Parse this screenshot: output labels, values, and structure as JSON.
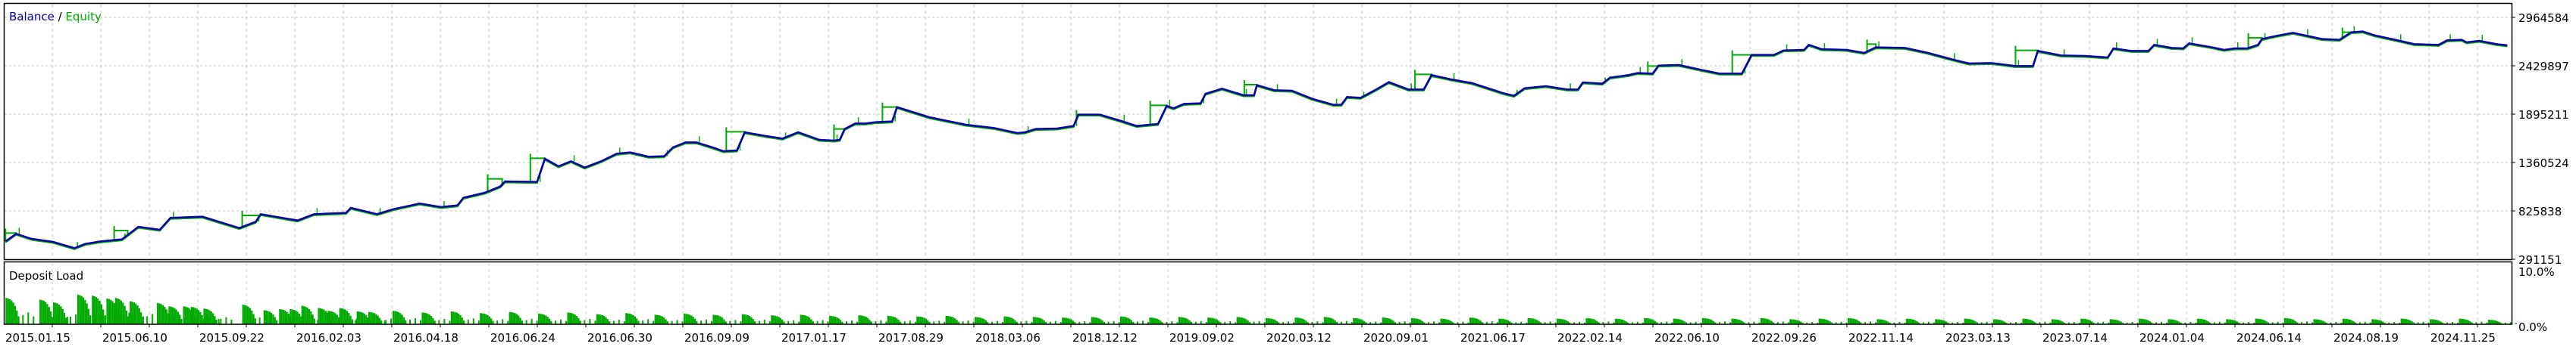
{
  "chart_data": [
    {
      "type": "line",
      "title": "",
      "legend": {
        "balance_label": "Balance",
        "separator": " / ",
        "equity_label": "Equity",
        "placement": "top-left"
      },
      "colors": {
        "balance": "#0000aa",
        "equity": "#00aa00",
        "grid": "#c8c8c8"
      },
      "ylim": [
        291151,
        2964584
      ],
      "y_ticks": [
        2964584,
        2429897,
        1895211,
        1360524,
        825838,
        291151
      ],
      "y_tick_labels": [
        "2964584",
        "2429897",
        "1895211",
        "1360524",
        "825838",
        "291151"
      ],
      "x_tick_labels": [
        "2015.01.15",
        "2015.06.10",
        "2015.09.22",
        "2016.02.03",
        "2016.04.18",
        "2016.06.24",
        "2016.06.30",
        "2016.09.09",
        "2017.01.17",
        "2017.08.29",
        "2018.03.06",
        "2018.12.12",
        "2019.09.02",
        "2020.03.12",
        "2020.09.01",
        "2021.06.17",
        "2022.02.14",
        "2022.06.10",
        "2022.09.26",
        "2022.11.14",
        "2023.03.13",
        "2023.07.14",
        "2024.01.04",
        "2024.06.14",
        "2024.08.19",
        "2024.11.25"
      ],
      "x_unit": "tick index (0 = 2015.01.15)",
      "grid": true,
      "balance": [
        [
          0.01,
          488900
        ],
        [
          0.12,
          572400
        ],
        [
          0.28,
          516700
        ],
        [
          0.5,
          483300
        ],
        [
          0.72,
          413700
        ],
        [
          0.83,
          461000
        ],
        [
          0.99,
          488900
        ],
        [
          1.21,
          511200
        ],
        [
          1.38,
          650400
        ],
        [
          1.6,
          617000
        ],
        [
          1.71,
          748900
        ],
        [
          2.04,
          761800
        ],
        [
          2.42,
          636500
        ],
        [
          2.59,
          706100
        ],
        [
          2.64,
          789700
        ],
        [
          3.02,
          720000
        ],
        [
          3.19,
          789700
        ],
        [
          3.52,
          803600
        ],
        [
          3.57,
          859300
        ],
        [
          3.84,
          789700
        ],
        [
          4.01,
          845400
        ],
        [
          4.28,
          906700
        ],
        [
          4.5,
          867700
        ],
        [
          4.67,
          887200
        ],
        [
          4.73,
          970700
        ],
        [
          4.95,
          1026400
        ],
        [
          5.11,
          1096000
        ],
        [
          5.16,
          1151700
        ],
        [
          5.49,
          1146200
        ],
        [
          5.57,
          1402400
        ],
        [
          5.71,
          1318800
        ],
        [
          5.84,
          1374500
        ],
        [
          5.98,
          1304900
        ],
        [
          6.15,
          1374500
        ],
        [
          6.31,
          1458000
        ],
        [
          6.45,
          1471900
        ],
        [
          6.64,
          1424600
        ],
        [
          6.8,
          1430200
        ],
        [
          6.89,
          1527600
        ],
        [
          7.02,
          1583300
        ],
        [
          7.13,
          1583300
        ],
        [
          7.3,
          1527600
        ],
        [
          7.41,
          1485900
        ],
        [
          7.55,
          1494300
        ],
        [
          7.63,
          1694800
        ],
        [
          7.85,
          1653000
        ],
        [
          8.02,
          1625200
        ],
        [
          8.18,
          1694800
        ],
        [
          8.4,
          1611200
        ],
        [
          8.55,
          1602800
        ],
        [
          8.61,
          1611200
        ],
        [
          8.66,
          1730900
        ],
        [
          8.77,
          1792200
        ],
        [
          8.88,
          1792200
        ],
        [
          8.98,
          1806100
        ],
        [
          9.15,
          1814500
        ],
        [
          9.2,
          1973200
        ],
        [
          9.53,
          1861900
        ],
        [
          9.91,
          1778300
        ],
        [
          10.2,
          1742100
        ],
        [
          10.44,
          1686400
        ],
        [
          10.52,
          1694800
        ],
        [
          10.63,
          1730900
        ],
        [
          10.85,
          1736500
        ],
        [
          11.02,
          1764300
        ],
        [
          11.07,
          1889700
        ],
        [
          11.29,
          1889700
        ],
        [
          11.51,
          1820000
        ],
        [
          11.67,
          1764300
        ],
        [
          11.89,
          1786600
        ],
        [
          11.98,
          1987100
        ],
        [
          12.05,
          1959300
        ],
        [
          12.16,
          2009400
        ],
        [
          12.33,
          2015000
        ],
        [
          12.38,
          2120800
        ],
        [
          12.55,
          2176500
        ],
        [
          12.77,
          2104100
        ],
        [
          12.88,
          2104100
        ],
        [
          12.91,
          2215500
        ],
        [
          13.09,
          2159800
        ],
        [
          13.27,
          2154200
        ],
        [
          13.48,
          2065100
        ],
        [
          13.7,
          1998300
        ],
        [
          13.78,
          1998300
        ],
        [
          13.84,
          2084600
        ],
        [
          13.98,
          2076200
        ],
        [
          14.14,
          2168100
        ],
        [
          14.27,
          2248900
        ],
        [
          14.47,
          2168100
        ],
        [
          14.63,
          2168100
        ],
        [
          14.71,
          2326800
        ],
        [
          14.91,
          2279500
        ],
        [
          15.13,
          2237700
        ],
        [
          15.45,
          2126300
        ],
        [
          15.56,
          2098500
        ],
        [
          15.67,
          2182000
        ],
        [
          15.89,
          2204300
        ],
        [
          16.11,
          2168100
        ],
        [
          16.22,
          2168100
        ],
        [
          16.27,
          2246100
        ],
        [
          16.47,
          2232200
        ],
        [
          16.55,
          2299000
        ],
        [
          16.74,
          2326800
        ],
        [
          16.83,
          2349000
        ],
        [
          16.99,
          2343500
        ],
        [
          17.05,
          2432600
        ],
        [
          17.26,
          2438200
        ],
        [
          17.5,
          2382500
        ],
        [
          17.68,
          2343500
        ],
        [
          17.91,
          2343500
        ],
        [
          18.01,
          2549600
        ],
        [
          18.24,
          2549600
        ],
        [
          18.34,
          2599600
        ],
        [
          18.55,
          2605400
        ],
        [
          18.6,
          2661100
        ],
        [
          18.73,
          2613700
        ],
        [
          18.99,
          2605400
        ],
        [
          19.17,
          2572000
        ],
        [
          19.29,
          2633200
        ],
        [
          19.59,
          2627600
        ],
        [
          19.83,
          2572000
        ],
        [
          20.07,
          2502300
        ],
        [
          20.25,
          2455000
        ],
        [
          20.48,
          2460500
        ],
        [
          20.73,
          2427100
        ],
        [
          20.91,
          2427100
        ],
        [
          20.96,
          2594000
        ],
        [
          21.2,
          2544100
        ],
        [
          21.45,
          2538500
        ],
        [
          21.68,
          2521800
        ],
        [
          21.74,
          2622100
        ],
        [
          21.92,
          2594000
        ],
        [
          22.1,
          2594000
        ],
        [
          22.16,
          2661100
        ],
        [
          22.34,
          2627600
        ],
        [
          22.46,
          2622100
        ],
        [
          22.52,
          2677800
        ],
        [
          22.76,
          2633200
        ],
        [
          22.88,
          2605400
        ],
        [
          22.99,
          2622100
        ],
        [
          23.12,
          2622100
        ],
        [
          23.23,
          2661100
        ],
        [
          23.27,
          2725100
        ],
        [
          23.41,
          2758500
        ],
        [
          23.59,
          2794500
        ],
        [
          23.71,
          2766900
        ],
        [
          23.89,
          2725100
        ],
        [
          24.07,
          2716700
        ],
        [
          24.19,
          2800300
        ],
        [
          24.31,
          2808600
        ],
        [
          24.43,
          2766900
        ],
        [
          24.67,
          2711100
        ],
        [
          24.84,
          2669300
        ],
        [
          25.09,
          2661100
        ],
        [
          25.18,
          2711100
        ],
        [
          25.33,
          2716700
        ],
        [
          25.38,
          2688900
        ],
        [
          25.51,
          2705600
        ],
        [
          25.69,
          2669300
        ],
        [
          25.8,
          2655500
        ]
      ],
      "equity_plateaus": [
        [
          0.01,
          0.12,
          580700
        ],
        [
          1.13,
          1.27,
          608600
        ],
        [
          2.45,
          2.64,
          775800
        ],
        [
          4.98,
          5.13,
          1179500
        ],
        [
          5.42,
          5.57,
          1407900
        ],
        [
          7.44,
          7.63,
          1700300
        ],
        [
          8.55,
          8.66,
          1730900
        ],
        [
          9.05,
          9.2,
          1973200
        ],
        [
          11.05,
          11.29,
          1889700
        ],
        [
          11.81,
          11.98,
          1992700
        ],
        [
          12.78,
          12.91,
          2221100
        ],
        [
          14.54,
          14.71,
          2335200
        ],
        [
          16.94,
          17.05,
          2427100
        ],
        [
          17.81,
          18.01,
          2549600
        ],
        [
          19.2,
          19.29,
          2669300
        ],
        [
          20.73,
          20.96,
          2599600
        ],
        [
          23.13,
          23.27,
          2739000
        ],
        [
          24.1,
          24.19,
          2800300
        ]
      ]
    },
    {
      "type": "bar",
      "title": "Deposit Load",
      "ylim": [
        0,
        10
      ],
      "y_tick_labels": [
        "10.0%",
        "0.0%"
      ],
      "color": "#00aa00",
      "load_peaks_percent": [
        [
          0.01,
          4.7
        ],
        [
          0.36,
          4.4
        ],
        [
          0.5,
          3.9
        ],
        [
          0.75,
          5.3
        ],
        [
          0.9,
          5.1
        ],
        [
          1.05,
          4.6
        ],
        [
          1.14,
          4.7
        ],
        [
          1.29,
          4.1
        ],
        [
          1.57,
          3.8
        ],
        [
          1.69,
          3.2
        ],
        [
          1.84,
          3.2
        ],
        [
          1.92,
          3.1
        ],
        [
          2.05,
          2.8
        ],
        [
          2.45,
          3.5
        ],
        [
          2.67,
          2.5
        ],
        [
          2.83,
          2.7
        ],
        [
          2.94,
          2.7
        ],
        [
          3.06,
          3.3
        ],
        [
          3.23,
          2.9
        ],
        [
          3.33,
          2.4
        ],
        [
          3.45,
          2.9
        ],
        [
          3.63,
          2.3
        ],
        [
          3.75,
          2.2
        ],
        [
          4.0,
          2.4
        ],
        [
          4.3,
          2.1
        ],
        [
          4.6,
          2.3
        ],
        [
          4.9,
          2.0
        ],
        [
          5.2,
          2.2
        ],
        [
          5.5,
          1.9
        ],
        [
          5.8,
          2.1
        ],
        [
          6.1,
          1.8
        ],
        [
          6.4,
          2.0
        ],
        [
          6.7,
          1.7
        ],
        [
          7.0,
          1.9
        ],
        [
          7.3,
          1.7
        ],
        [
          7.6,
          1.8
        ],
        [
          7.9,
          1.6
        ],
        [
          8.2,
          1.7
        ],
        [
          8.5,
          1.5
        ],
        [
          8.8,
          1.6
        ],
        [
          9.1,
          1.5
        ],
        [
          9.4,
          1.4
        ],
        [
          9.7,
          1.5
        ],
        [
          10.0,
          1.3
        ],
        [
          10.3,
          1.4
        ],
        [
          10.6,
          1.3
        ],
        [
          10.9,
          1.2
        ],
        [
          11.2,
          1.3
        ],
        [
          11.5,
          1.4
        ],
        [
          11.8,
          1.2
        ],
        [
          12.1,
          1.3
        ],
        [
          12.4,
          1.2
        ],
        [
          12.7,
          1.3
        ],
        [
          13.0,
          1.1
        ],
        [
          13.3,
          1.2
        ],
        [
          13.6,
          1.3
        ],
        [
          13.9,
          1.1
        ],
        [
          14.2,
          1.2
        ],
        [
          14.5,
          1.1
        ],
        [
          14.8,
          1.0
        ],
        [
          15.1,
          1.2
        ],
        [
          15.4,
          1.0
        ],
        [
          15.7,
          1.1
        ],
        [
          16.0,
          1.0
        ],
        [
          16.3,
          1.1
        ],
        [
          16.6,
          1.0
        ],
        [
          16.9,
          1.1
        ],
        [
          17.2,
          1.0
        ],
        [
          17.5,
          1.1
        ],
        [
          17.8,
          1.0
        ],
        [
          18.1,
          1.1
        ],
        [
          18.4,
          0.9
        ],
        [
          18.7,
          1.0
        ],
        [
          19.0,
          1.1
        ],
        [
          19.3,
          0.9
        ],
        [
          19.6,
          1.0
        ],
        [
          19.9,
          0.9
        ],
        [
          20.2,
          1.0
        ],
        [
          20.5,
          0.9
        ],
        [
          20.8,
          1.0
        ],
        [
          21.1,
          0.9
        ],
        [
          21.4,
          1.0
        ],
        [
          21.7,
          0.9
        ],
        [
          22.0,
          1.0
        ],
        [
          22.3,
          0.9
        ],
        [
          22.6,
          1.0
        ],
        [
          22.9,
          0.9
        ],
        [
          23.2,
          1.0
        ],
        [
          23.5,
          1.1
        ],
        [
          23.8,
          0.9
        ],
        [
          24.1,
          1.0
        ],
        [
          24.4,
          0.9
        ],
        [
          24.7,
          1.0
        ],
        [
          25.0,
          0.9
        ],
        [
          25.3,
          1.0
        ],
        [
          25.6,
          0.8
        ]
      ]
    }
  ]
}
